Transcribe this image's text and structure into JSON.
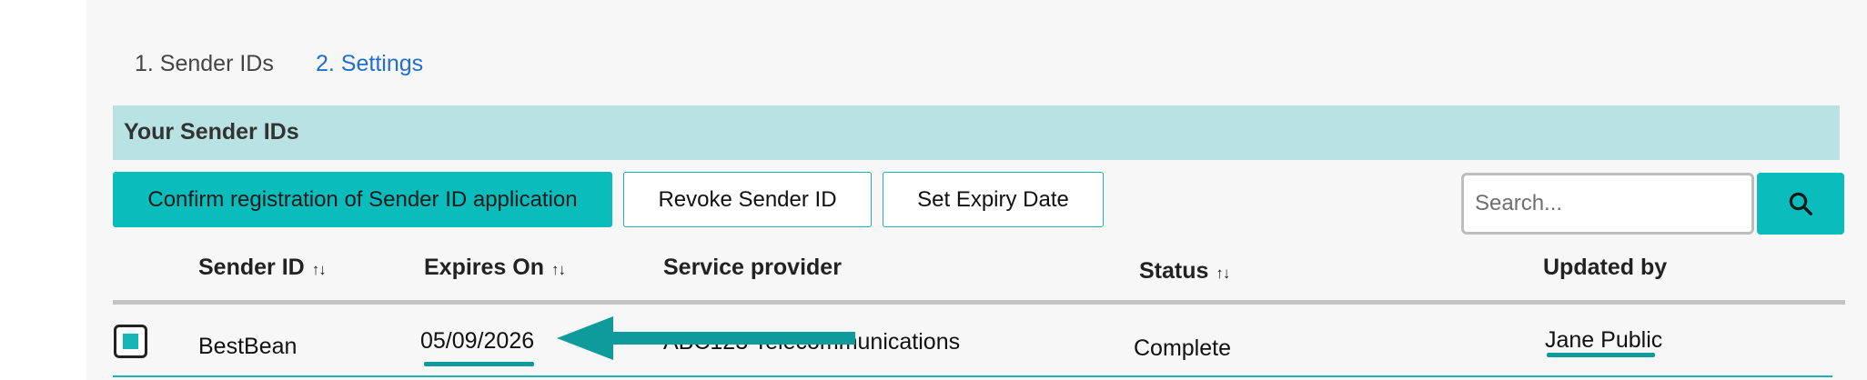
{
  "tabs": [
    {
      "label": "1. Sender IDs"
    },
    {
      "label": "2. Settings"
    }
  ],
  "section": {
    "title": "Your Sender IDs"
  },
  "toolbar": {
    "confirm_label": "Confirm registration of Sender ID application",
    "revoke_label": "Revoke Sender ID",
    "expiry_label": "Set Expiry Date",
    "search_placeholder": "Search...",
    "search_value": ""
  },
  "table": {
    "columns": [
      {
        "label": "Sender ID",
        "sortable": true
      },
      {
        "label": "Expires On",
        "sortable": true
      },
      {
        "label": "Service provider",
        "sortable": false
      },
      {
        "label": "Status",
        "sortable": true
      },
      {
        "label": "Updated by",
        "sortable": false
      }
    ],
    "sort_glyph": "↑↓",
    "rows": [
      {
        "checked": true,
        "sender_id": "BestBean",
        "expires_on": "05/09/2026",
        "service_provider": "ABC123 Telecommunications",
        "status": "Complete",
        "updated_by": "Jane Public"
      }
    ]
  },
  "colors": {
    "accent": "#0bbcbc",
    "banner": "#b9e3e2",
    "link": "#1f6fd0",
    "annotation": "#0f9b9b"
  },
  "icons": {
    "search": "search-icon",
    "annotation": "arrow-left-icon"
  }
}
